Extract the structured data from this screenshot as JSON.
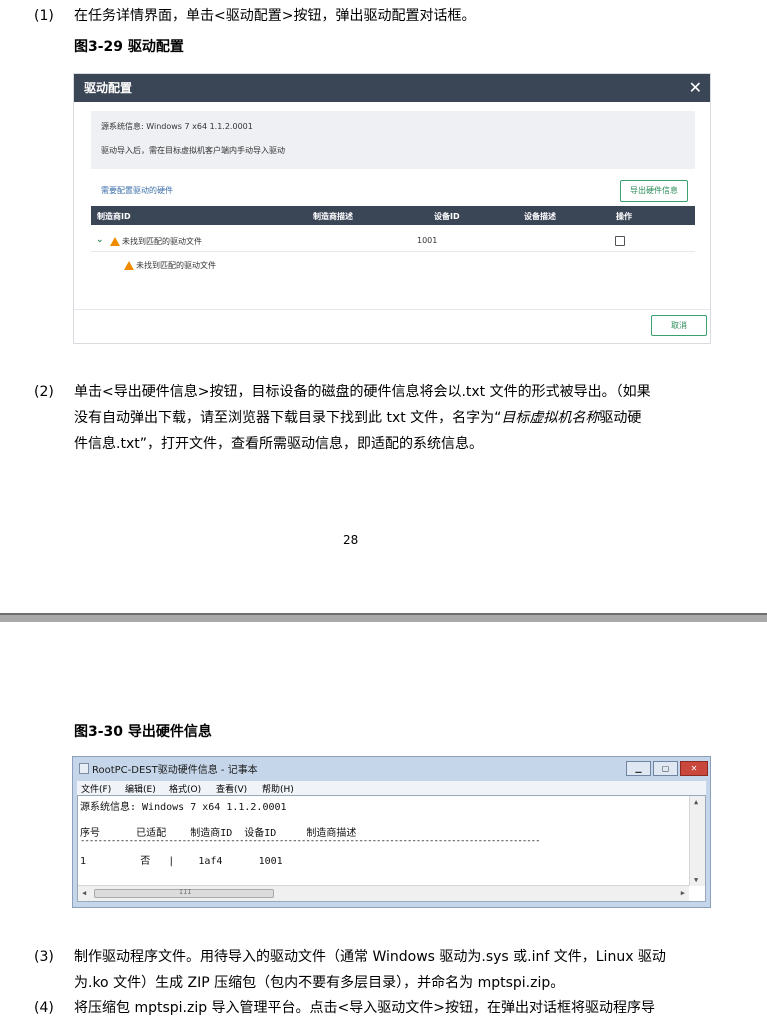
{
  "step1": {
    "num": "(1)",
    "text": "在任务详情界面，单击<驱动配置>按钮，弹出驱动配置对话框。"
  },
  "fig29": {
    "caption": "图3-29  驱动配置"
  },
  "dialog": {
    "title": "驱动配置",
    "close_icon": "close-icon",
    "source_info": "源系统信息: Windows 7 x64 1.1.2.0001",
    "notice": "驱动导入后，需在目标虚拟机客户端内手动导入驱动",
    "section_label": "需要配置驱动的硬件",
    "export_button": "导出硬件信息",
    "columns": [
      "制造商ID",
      "制造商描述",
      "设备ID",
      "设备描述",
      "操作"
    ],
    "row1": {
      "mfr_id": "未找到匹配的驱动文件",
      "device_id": "1001"
    },
    "row2": {
      "mfr_id": "未找到匹配的驱动文件"
    },
    "cancel_button": "取消"
  },
  "step2": {
    "num": "(2)",
    "line1": "单击<导出硬件信息>按钮，目标设备的磁盘的硬件信息将会以.txt 文件的形式被导出。（如果",
    "line2_a": "没有自动弹出下载，请至浏览器下载目录下找到此 txt 文件，名字为“",
    "line2_em": "目标虚拟机名称",
    "line2_b": "驱动硬",
    "line3": "件信息.txt”，打开文件，查看所需驱动信息，即适配的系统信息。"
  },
  "page_number": "28",
  "fig30": {
    "caption": "图3-30  导出硬件信息"
  },
  "notepad": {
    "title": "RootPC-DEST驱动硬件信息 - 记事本",
    "menu": [
      "文件(F)",
      "编辑(E)",
      "格式(O)",
      "查看(V)",
      "帮助(H)"
    ],
    "line1": "源系统信息: Windows 7 x64 1.1.2.0001",
    "header": "序号      已适配    制造商ID  设备ID     制造商描述",
    "dashes": "--------------------------------------------------------------------------------------------------------",
    "row": "1         否   |    1af4      1001",
    "scroll_mark": "III"
  },
  "step3": {
    "num": "(3)",
    "line1": "制作驱动程序文件。用待导入的驱动文件（通常 Windows 驱动为.sys 或.inf 文件，Linux 驱动",
    "line2": "为.ko 文件）生成 ZIP 压缩包（包内不要有多层目录），并命名为 mptspi.zip。"
  },
  "step4": {
    "num": "(4)",
    "line1": "将压缩包 mptspi.zip 导入管理平台。点击<导入驱动文件>按钮，在弹出对话框将驱动程序导"
  }
}
